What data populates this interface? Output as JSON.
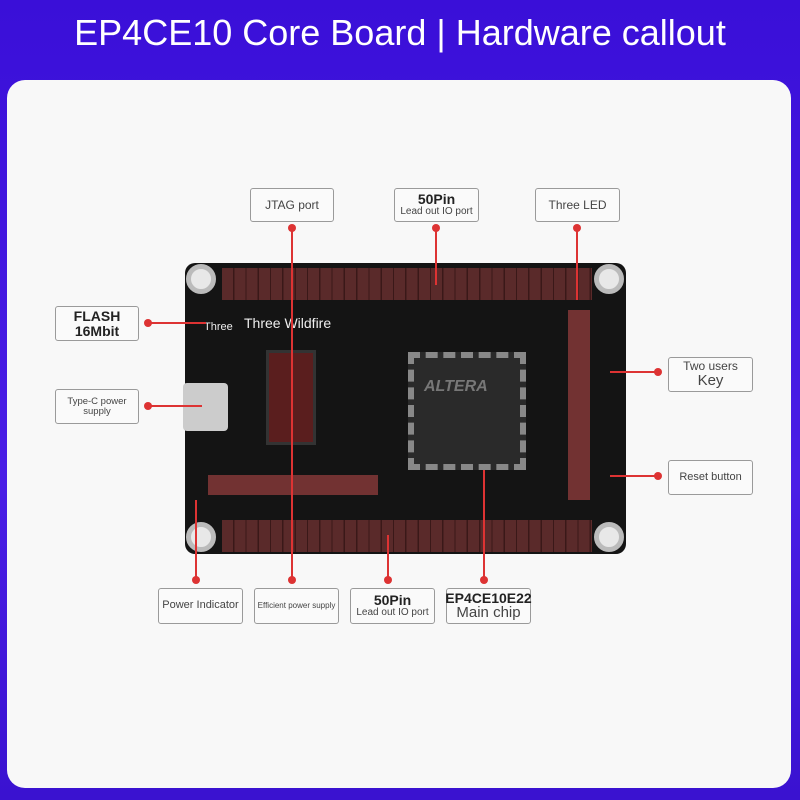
{
  "title": "EP4CE10 Core Board | Hardware callout",
  "callouts": {
    "jtag": "JTAG port",
    "pin50_top_title": "50Pin",
    "pin50_top_sub": "Lead out IO port",
    "led": "Three LED",
    "flash_l1": "FLASH",
    "flash_l2": "16Mbit",
    "typec": "Type-C power supply",
    "keys_l1": "Two users",
    "keys_l2": "Key",
    "reset": "Reset button",
    "power_ind": "Power Indicator",
    "eff_power": "Efficient power supply",
    "pin50_bot_title": "50Pin",
    "pin50_bot_sub": "Lead out IO port",
    "chip_title": "EP4CE10E22",
    "chip_sub": "Main chip"
  },
  "board": {
    "overlay_small": "Three",
    "overlay_large": "Three Wildfire",
    "chip_logo": "ALTERA"
  },
  "accent": "#dd3333"
}
